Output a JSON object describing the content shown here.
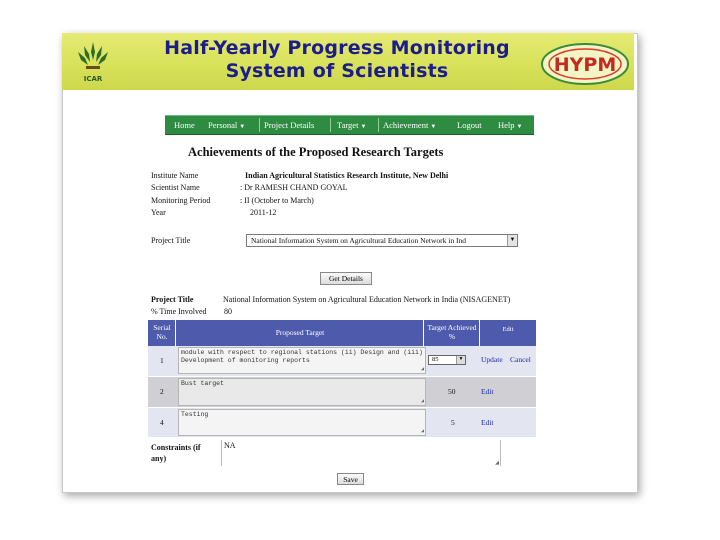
{
  "banner": {
    "title_line1": "Half-Yearly Progress Monitoring",
    "title_line2": "System of Scientists",
    "logo_left_text": "ICAR",
    "logo_right_text": "HYPM"
  },
  "nav": {
    "items": [
      {
        "label": "Home",
        "dropdown": false
      },
      {
        "label": "Personal",
        "dropdown": true
      },
      {
        "label": "Project Details",
        "dropdown": false
      },
      {
        "label": "Target",
        "dropdown": true
      },
      {
        "label": "Achievement",
        "dropdown": true
      },
      {
        "label": "Logout",
        "dropdown": false
      },
      {
        "label": "Help",
        "dropdown": true
      }
    ],
    "caret": "▼"
  },
  "page": {
    "heading": "Achievements of the Proposed Research Targets",
    "institute_label": "Institute Name",
    "institute_value": "Indian Agricultural Statistics Research Institute, New Delhi",
    "scientist_label": "Scientist Name",
    "scientist_value": ": Dr RAMESH CHAND GOYAL",
    "period_label": "Monitoring Period",
    "period_value": ": II (October to March)",
    "year_label": "Year",
    "year_value": "2011-12",
    "project_title_label": "Project Title",
    "project_select_value": "National Information System on Agricultural Education Network in Ind",
    "get_details_button": "Get Details"
  },
  "project": {
    "title_label": "Project Title",
    "title_value": "National Information System on Agricultural Education Network in India (NISAGENET)",
    "time_label": "% Time Involved",
    "time_value": "80"
  },
  "table": {
    "headers": {
      "serial": "Serial No.",
      "target": "Proposed Target",
      "achieved": "Target Achieved %",
      "edit": "Edit"
    },
    "rows": [
      {
        "serial": "1",
        "target": "module with respect to regional stations (ii) Design and (iii) Development of monitoring reports",
        "achieved": "85",
        "actions": [
          "Update",
          "Cancel"
        ]
      },
      {
        "serial": "2",
        "target": "Bust target",
        "achieved": "50",
        "actions": [
          "Edit"
        ]
      },
      {
        "serial": "4",
        "target": "Testing",
        "achieved": "5",
        "actions": [
          "Edit"
        ]
      }
    ]
  },
  "constraints": {
    "label": "Constraints (if any)",
    "value": "NA"
  },
  "save_button": "Save",
  "colors": {
    "banner": "#d8e25a",
    "nav": "#2e8b42",
    "table_header": "#4e5bac",
    "row_light": "#e3e5f0",
    "row_grey": "#cfcfd4",
    "link": "#1c2aa8"
  }
}
